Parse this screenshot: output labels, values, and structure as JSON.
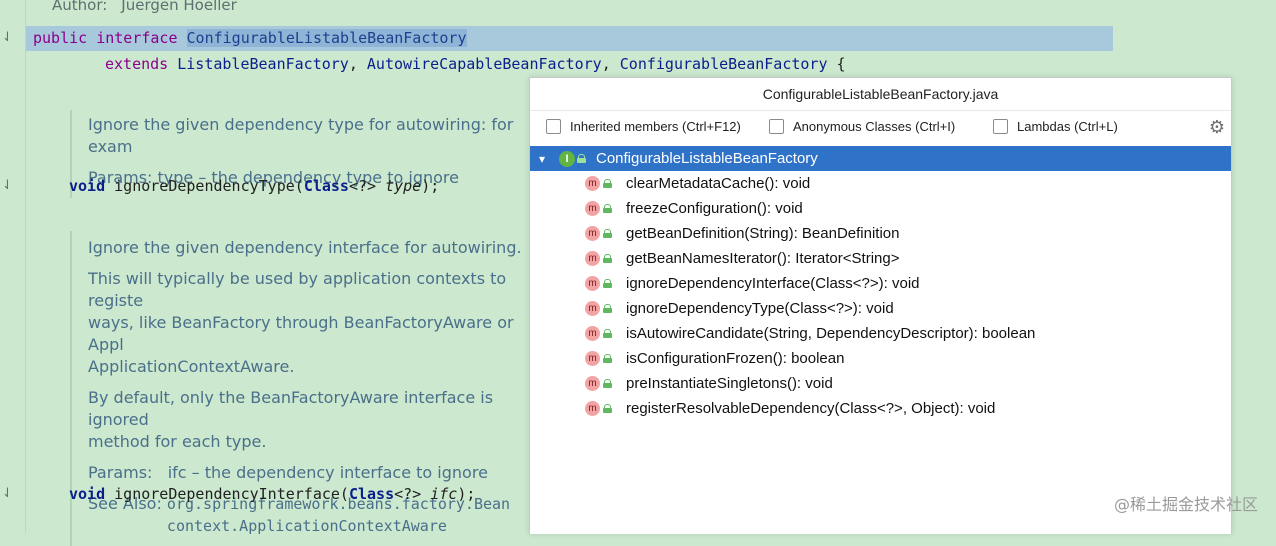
{
  "editor": {
    "author_label": "Author:",
    "author_name": "Juergen Hoeller",
    "decl_public": "public",
    "decl_interface": "interface",
    "interface_name": "ConfigurableListableBeanFactory",
    "extends_kw": "extends",
    "extends_1": "ListableBeanFactory",
    "extends_2": "AutowireCapableBeanFactory",
    "extends_3": "ConfigurableBeanFactory",
    "brace": "{",
    "doc1": {
      "line1": "Ignore the given dependency type for autowiring: for exam",
      "params": "Params: type – the dependency type to ignore"
    },
    "method1": {
      "ret": "void",
      "name": "ignoreDependencyType(",
      "type": "Class",
      "generic": "<?> ",
      "param": "type",
      "end": ");"
    },
    "doc2": {
      "line1": "Ignore the given dependency interface for autowiring.",
      "line2a": "This will typically be used by application contexts to registe",
      "line2b": "ways, like BeanFactory through BeanFactoryAware or Appl",
      "line2c": "ApplicationContextAware.",
      "line3a": "By default, only the BeanFactoryAware interface is ignored",
      "line3b": "method for each type.",
      "params": "Params:   ifc – the dependency interface to ignore",
      "see_label": "See Also: ",
      "see_1": "org.springframework.beans.factory.Bean",
      "see_2": "context.ApplicationContextAware"
    },
    "method2": {
      "ret": "void",
      "name": "ignoreDependencyInterface(",
      "type": "Class",
      "generic": "<?> ",
      "param": "ifc",
      "end": ");"
    }
  },
  "popup": {
    "title": "ConfigurableListableBeanFactory.java",
    "filters": [
      {
        "label": "Inherited members (Ctrl+F12)",
        "checked": false
      },
      {
        "label": "Anonymous Classes (Ctrl+I)",
        "checked": false
      },
      {
        "label": "Lambdas (Ctrl+L)",
        "checked": false
      }
    ],
    "root": {
      "icon": "I",
      "label": "ConfigurableListableBeanFactory"
    },
    "methods": [
      "clearMetadataCache(): void",
      "freezeConfiguration(): void",
      "getBeanDefinition(String): BeanDefinition",
      "getBeanNamesIterator(): Iterator<String>",
      "ignoreDependencyInterface(Class<?>): void",
      "ignoreDependencyType(Class<?>): void",
      "isAutowireCandidate(String, DependencyDescriptor): boolean",
      "isConfigurationFrozen(): boolean",
      "preInstantiateSingletons(): void",
      "registerResolvableDependency(Class<?>, Object): void"
    ],
    "method_icon": "m"
  },
  "watermark": "@稀土掘金技术社区",
  "colors": {
    "background": "#cce8cf",
    "selection": "#2f73c9",
    "method_icon": "#f2a3a3",
    "interface_icon": "#62b543"
  }
}
